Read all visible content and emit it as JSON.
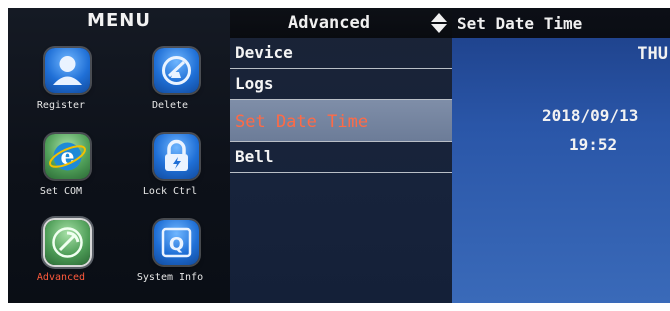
{
  "menu": {
    "title": "MENU",
    "items": [
      {
        "label": "Register",
        "icon": "user-icon"
      },
      {
        "label": "Delete",
        "icon": "delete-icon"
      },
      {
        "label": "Set COM",
        "icon": "ie-globe-icon"
      },
      {
        "label": "Lock Ctrl",
        "icon": "lock-icon"
      },
      {
        "label": "Advanced",
        "icon": "pickaxe-icon",
        "active": true
      },
      {
        "label": "System Info",
        "icon": "q-info-icon"
      }
    ],
    "active_label_color": "#ff5a3c"
  },
  "advanced": {
    "title": "Advanced",
    "items": [
      "Device",
      "Logs",
      "Set Date Time",
      "Bell"
    ],
    "selected_index": 2,
    "selected_color": "#ff6a45"
  },
  "set_date_time": {
    "title": "Set Date Time",
    "day": "THU",
    "date": "2018/09/13",
    "time": "19:52"
  }
}
